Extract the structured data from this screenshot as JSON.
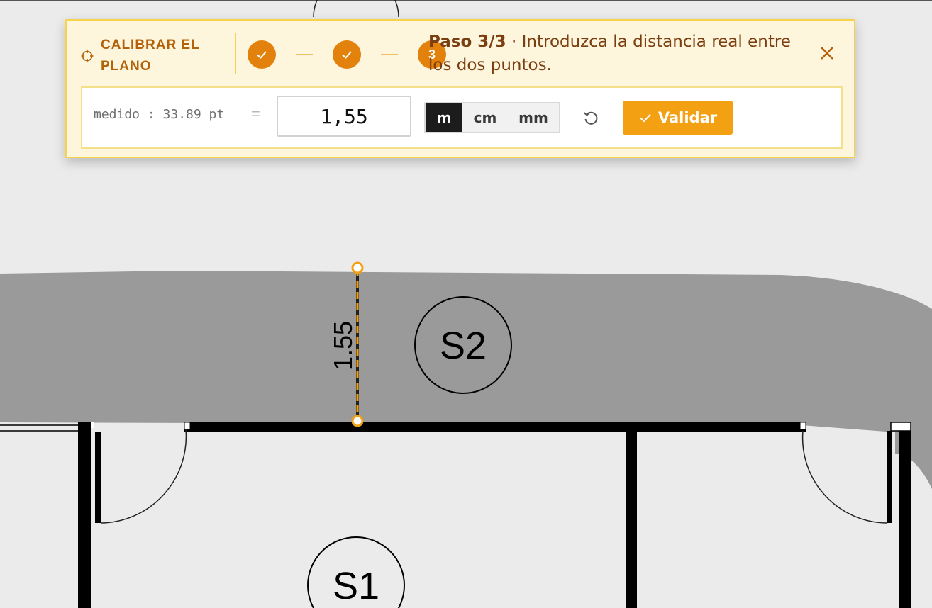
{
  "panel": {
    "title": "CALIBRAR EL PLANO",
    "steps": [
      {
        "state": "done",
        "label": ""
      },
      {
        "state": "done",
        "label": ""
      },
      {
        "state": "current",
        "label": "3"
      }
    ],
    "instruction_step": "Paso 3/3",
    "instruction_sep": " · ",
    "instruction_text": "Introduzca la distancia real entre los dos puntos.",
    "measured_label": "medido : 33.89 pt",
    "equals": "=",
    "value": "1,55",
    "units": [
      "m",
      "cm",
      "mm"
    ],
    "active_unit": "m",
    "validate_label": "Validar",
    "icons": {
      "title": "target-icon",
      "done_step": "check-icon",
      "close": "close-icon",
      "reset": "reset-icon",
      "validate": "check-icon"
    },
    "colors": {
      "accent": "#f3a012",
      "step": "#e2810c",
      "panel_bg": "#fdf5dc",
      "panel_border": "#f5d34a",
      "title": "#b4620a",
      "text": "#7a3e10"
    }
  },
  "plan": {
    "dimension_label": "1.55",
    "room_labels": [
      "S2",
      "S1"
    ],
    "colors": {
      "background": "#ebebeb",
      "corridor": "#9a9a9a",
      "wall": "#000000",
      "measure_line": "#f3a012"
    }
  }
}
